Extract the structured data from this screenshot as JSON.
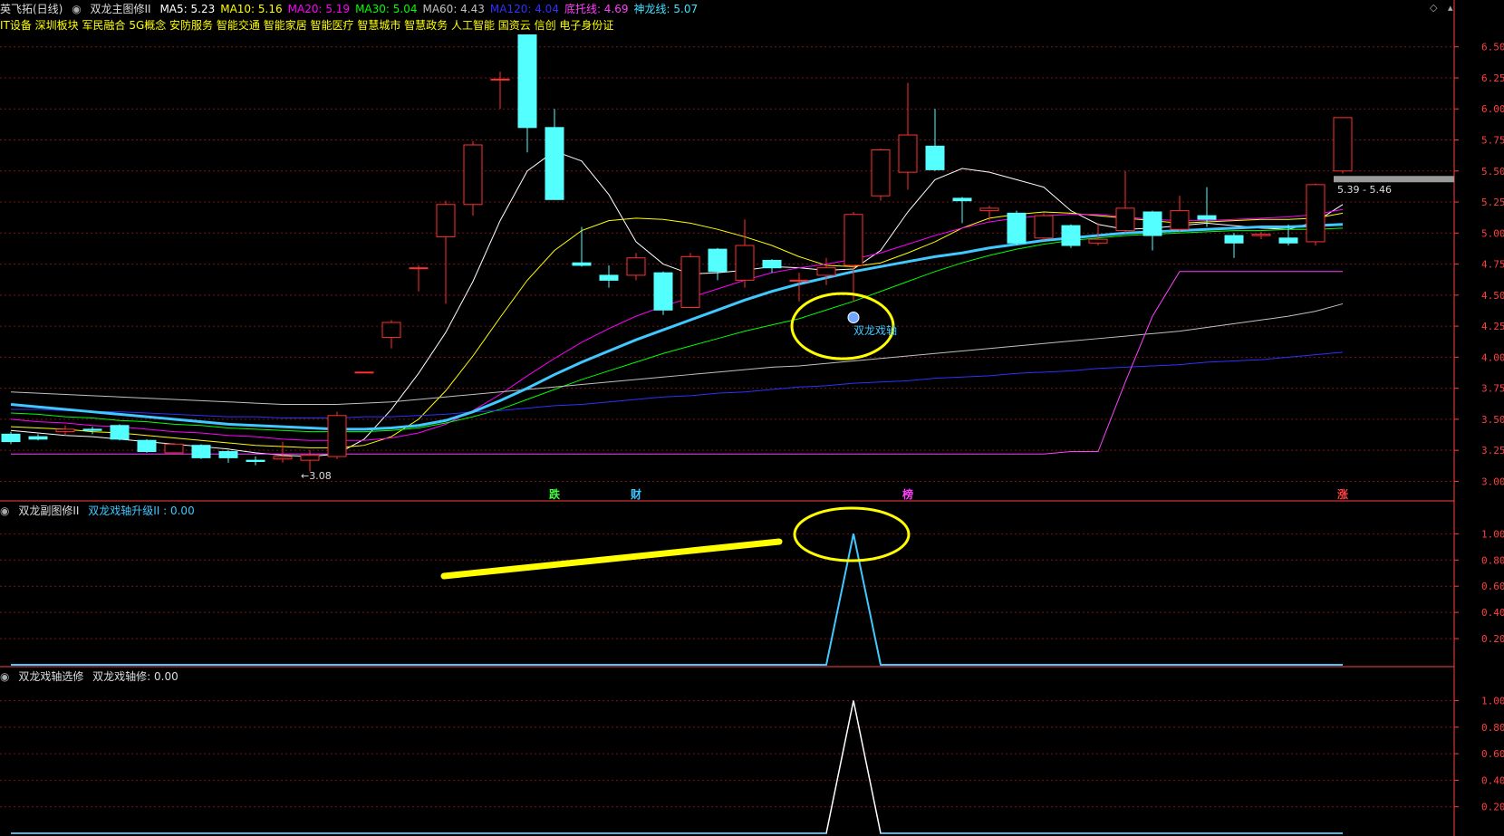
{
  "header": {
    "stock_name": "英飞拓(日线)",
    "indicator_name": "双龙主图修II",
    "ma_items": [
      {
        "label": "MA5: 5.23",
        "color": "#ffffff"
      },
      {
        "label": "MA10: 5.16",
        "color": "#ffff00"
      },
      {
        "label": "MA20: 5.19",
        "color": "#ff00ff"
      },
      {
        "label": "MA30: 5.04",
        "color": "#00ff00"
      },
      {
        "label": "MA60: 4.43",
        "color": "#c0c0c0"
      },
      {
        "label": "MA120: 4.04",
        "color": "#3030ff"
      },
      {
        "label": "底托线: 4.69",
        "color": "#ff40ff"
      },
      {
        "label": "神龙线: 5.07",
        "color": "#40e0ff"
      }
    ],
    "concepts": "IT设备 深圳板块 军民融合 5G概念 安防服务 智能交通 智能家居 智能医疗 智慧城市 智慧政务 人工智能 国资云 信创 电子身份证"
  },
  "colors": {
    "up": "#ff3030",
    "down": "#54ffff",
    "grid": "#7a1515",
    "axis": "#ff4040",
    "shenlong": "#40c8ff"
  },
  "annotations": {
    "signal_label": "双龙戏轴",
    "low_label": "←3.08",
    "range_label": "5.39 - 5.46",
    "markers": [
      {
        "text": "跌",
        "color": "#40ff40",
        "idx": 20
      },
      {
        "text": "财",
        "color": "#40c8ff",
        "idx": 23
      },
      {
        "text": "榜",
        "color": "#ff40ff",
        "idx": 33
      },
      {
        "text": "涨",
        "color": "#ff4040",
        "idx": 49
      }
    ]
  },
  "panel2": {
    "title": "双龙副图修II",
    "value_label": "双龙戏轴升级II : 0.00"
  },
  "panel3": {
    "title": "双龙戏轴选修",
    "value_label": "双龙戏轴修: 0.00"
  },
  "chart_data": [
    {
      "type": "candlestick",
      "name": "main",
      "ylim": [
        2.85,
        6.6
      ],
      "yticks": [
        "6.50",
        "6.25",
        "6.00",
        "5.75",
        "5.50",
        "5.25",
        "5.00",
        "4.75",
        "4.50",
        "4.25",
        "4.00",
        "3.75",
        "3.50",
        "3.25",
        "3.00"
      ],
      "candles": [
        {
          "o": 3.38,
          "c": 3.32,
          "h": 3.4,
          "l": 3.3
        },
        {
          "o": 3.36,
          "c": 3.34,
          "h": 3.38,
          "l": 3.33
        },
        {
          "o": 3.4,
          "c": 3.42,
          "h": 3.45,
          "l": 3.37
        },
        {
          "o": 3.42,
          "c": 3.41,
          "h": 3.44,
          "l": 3.38
        },
        {
          "o": 3.45,
          "c": 3.34,
          "h": 3.46,
          "l": 3.33
        },
        {
          "o": 3.33,
          "c": 3.24,
          "h": 3.34,
          "l": 3.23
        },
        {
          "o": 3.23,
          "c": 3.3,
          "h": 3.31,
          "l": 3.22
        },
        {
          "o": 3.29,
          "c": 3.19,
          "h": 3.3,
          "l": 3.18
        },
        {
          "o": 3.24,
          "c": 3.19,
          "h": 3.25,
          "l": 3.15
        },
        {
          "o": 3.17,
          "c": 3.16,
          "h": 3.2,
          "l": 3.13
        },
        {
          "o": 3.18,
          "c": 3.2,
          "h": 3.32,
          "l": 3.15
        },
        {
          "o": 3.17,
          "c": 3.21,
          "h": 3.25,
          "l": 3.08
        },
        {
          "o": 3.2,
          "c": 3.53,
          "h": 3.56,
          "l": 3.18
        },
        {
          "o": 3.88,
          "c": 3.88,
          "h": 3.88,
          "l": 3.88
        },
        {
          "o": 4.16,
          "c": 4.28,
          "h": 4.3,
          "l": 4.07
        },
        {
          "o": 4.72,
          "c": 4.72,
          "h": 4.74,
          "l": 4.53
        },
        {
          "o": 4.97,
          "c": 5.23,
          "h": 5.26,
          "l": 4.43
        },
        {
          "o": 5.23,
          "c": 5.71,
          "h": 5.74,
          "l": 5.14
        },
        {
          "o": 6.24,
          "c": 6.24,
          "h": 6.3,
          "l": 6.0
        },
        {
          "o": 6.9,
          "c": 5.85,
          "h": 6.9,
          "l": 5.65
        },
        {
          "o": 5.85,
          "c": 5.27,
          "h": 6.0,
          "l": 5.27
        },
        {
          "o": 4.76,
          "c": 4.74,
          "h": 5.05,
          "l": 4.73
        },
        {
          "o": 4.66,
          "c": 4.62,
          "h": 4.74,
          "l": 4.56
        },
        {
          "o": 4.66,
          "c": 4.8,
          "h": 4.84,
          "l": 4.62
        },
        {
          "o": 4.68,
          "c": 4.38,
          "h": 4.69,
          "l": 4.34
        },
        {
          "o": 4.4,
          "c": 4.81,
          "h": 4.84,
          "l": 4.4
        },
        {
          "o": 4.87,
          "c": 4.69,
          "h": 4.88,
          "l": 4.62
        },
        {
          "o": 4.62,
          "c": 4.9,
          "h": 5.11,
          "l": 4.56
        },
        {
          "o": 4.78,
          "c": 4.72,
          "h": 4.79,
          "l": 4.68
        },
        {
          "o": 4.62,
          "c": 4.62,
          "h": 4.68,
          "l": 4.45
        },
        {
          "o": 4.66,
          "c": 4.72,
          "h": 4.8,
          "l": 4.58
        },
        {
          "o": 4.74,
          "c": 5.15,
          "h": 5.17,
          "l": 4.45
        },
        {
          "o": 5.3,
          "c": 5.67,
          "h": 5.68,
          "l": 5.26
        },
        {
          "o": 5.49,
          "c": 5.79,
          "h": 6.21,
          "l": 5.35
        },
        {
          "o": 5.7,
          "c": 5.51,
          "h": 6.0,
          "l": 5.5
        },
        {
          "o": 5.28,
          "c": 5.26,
          "h": 5.29,
          "l": 5.08
        },
        {
          "o": 5.18,
          "c": 5.2,
          "h": 5.22,
          "l": 5.1
        },
        {
          "o": 5.16,
          "c": 4.92,
          "h": 5.18,
          "l": 4.9
        },
        {
          "o": 4.96,
          "c": 5.14,
          "h": 5.16,
          "l": 4.94
        },
        {
          "o": 5.06,
          "c": 4.9,
          "h": 5.07,
          "l": 4.88
        },
        {
          "o": 4.92,
          "c": 4.95,
          "h": 5.08,
          "l": 4.9
        },
        {
          "o": 5.02,
          "c": 5.2,
          "h": 5.5,
          "l": 5.0
        },
        {
          "o": 5.17,
          "c": 4.98,
          "h": 5.18,
          "l": 4.86
        },
        {
          "o": 5.03,
          "c": 5.18,
          "h": 5.3,
          "l": 5.0
        },
        {
          "o": 5.14,
          "c": 5.11,
          "h": 5.37,
          "l": 5.05
        },
        {
          "o": 4.98,
          "c": 4.92,
          "h": 5.0,
          "l": 4.8
        },
        {
          "o": 4.98,
          "c": 4.99,
          "h": 5.01,
          "l": 4.95
        },
        {
          "o": 4.96,
          "c": 4.92,
          "h": 5.07,
          "l": 4.9
        },
        {
          "o": 4.93,
          "c": 5.39,
          "h": 5.4,
          "l": 4.9
        },
        {
          "o": 5.5,
          "c": 5.93,
          "h": 5.93,
          "l": 5.48
        }
      ],
      "series": [
        {
          "name": "MA5",
          "color": "#ffffff",
          "width": 1,
          "values": [
            3.41,
            3.39,
            3.37,
            3.36,
            3.34,
            3.32,
            3.3,
            3.28,
            3.26,
            3.23,
            3.21,
            3.2,
            3.22,
            3.34,
            3.58,
            3.87,
            4.2,
            4.61,
            5.1,
            5.5,
            5.66,
            5.58,
            5.31,
            4.93,
            4.75,
            4.67,
            4.68,
            4.7,
            4.73,
            4.72,
            4.7,
            4.71,
            4.86,
            5.17,
            5.43,
            5.52,
            5.49,
            5.43,
            5.37,
            5.18,
            5.07,
            5.03,
            5.04,
            5.06,
            5.08,
            5.06,
            5.04,
            5.03,
            5.09,
            5.23
          ]
        },
        {
          "name": "MA10",
          "color": "#ffff00",
          "width": 1,
          "values": [
            3.44,
            3.43,
            3.42,
            3.4,
            3.39,
            3.37,
            3.35,
            3.33,
            3.31,
            3.29,
            3.28,
            3.27,
            3.27,
            3.29,
            3.36,
            3.5,
            3.73,
            4.01,
            4.32,
            4.62,
            4.86,
            5.02,
            5.1,
            5.12,
            5.11,
            5.08,
            5.03,
            4.97,
            4.9,
            4.81,
            4.74,
            4.73,
            4.76,
            4.84,
            4.93,
            5.04,
            5.12,
            5.15,
            5.17,
            5.16,
            5.14,
            5.12,
            5.1,
            5.08,
            5.09,
            5.1,
            5.11,
            5.11,
            5.12,
            5.16
          ]
        },
        {
          "name": "MA20",
          "color": "#ff00ff",
          "width": 1,
          "values": [
            3.5,
            3.48,
            3.47,
            3.45,
            3.44,
            3.42,
            3.4,
            3.39,
            3.37,
            3.36,
            3.34,
            3.33,
            3.33,
            3.33,
            3.35,
            3.39,
            3.46,
            3.57,
            3.7,
            3.85,
            3.99,
            4.12,
            4.23,
            4.33,
            4.41,
            4.48,
            4.55,
            4.62,
            4.68,
            4.72,
            4.75,
            4.79,
            4.84,
            4.91,
            4.98,
            5.04,
            5.09,
            5.12,
            5.14,
            5.15,
            5.15,
            5.13,
            5.11,
            5.1,
            5.1,
            5.11,
            5.12,
            5.13,
            5.15,
            5.19
          ]
        },
        {
          "name": "MA30",
          "color": "#00ff00",
          "width": 1,
          "values": [
            3.55,
            3.54,
            3.52,
            3.51,
            3.49,
            3.48,
            3.46,
            3.45,
            3.43,
            3.42,
            3.41,
            3.4,
            3.4,
            3.4,
            3.41,
            3.43,
            3.47,
            3.52,
            3.58,
            3.66,
            3.74,
            3.82,
            3.89,
            3.96,
            4.03,
            4.09,
            4.15,
            4.21,
            4.26,
            4.31,
            4.38,
            4.45,
            4.53,
            4.61,
            4.69,
            4.76,
            4.82,
            4.87,
            4.91,
            4.94,
            4.96,
            4.98,
            4.99,
            5.0,
            5.01,
            5.02,
            5.02,
            5.03,
            5.03,
            5.04
          ]
        },
        {
          "name": "MA60",
          "color": "#c0c0c0",
          "width": 1,
          "values": [
            3.72,
            3.71,
            3.7,
            3.69,
            3.68,
            3.67,
            3.66,
            3.65,
            3.64,
            3.63,
            3.62,
            3.62,
            3.62,
            3.63,
            3.64,
            3.66,
            3.68,
            3.7,
            3.72,
            3.74,
            3.76,
            3.78,
            3.8,
            3.82,
            3.84,
            3.86,
            3.88,
            3.9,
            3.92,
            3.93,
            3.95,
            3.97,
            3.99,
            4.01,
            4.03,
            4.05,
            4.07,
            4.09,
            4.11,
            4.13,
            4.15,
            4.17,
            4.19,
            4.21,
            4.24,
            4.27,
            4.3,
            4.33,
            4.37,
            4.43
          ]
        },
        {
          "name": "MA120",
          "color": "#3030ff",
          "width": 1,
          "values": [
            3.58,
            3.58,
            3.57,
            3.56,
            3.56,
            3.55,
            3.54,
            3.53,
            3.52,
            3.52,
            3.51,
            3.51,
            3.51,
            3.52,
            3.52,
            3.53,
            3.54,
            3.56,
            3.57,
            3.59,
            3.61,
            3.62,
            3.64,
            3.66,
            3.68,
            3.69,
            3.71,
            3.72,
            3.74,
            3.76,
            3.77,
            3.79,
            3.8,
            3.81,
            3.83,
            3.84,
            3.85,
            3.87,
            3.88,
            3.89,
            3.91,
            3.92,
            3.93,
            3.94,
            3.96,
            3.97,
            3.98,
            4.0,
            4.02,
            4.04
          ]
        },
        {
          "name": "底托线",
          "color": "#ff40ff",
          "width": 1,
          "values": [
            3.22,
            3.22,
            3.22,
            3.22,
            3.22,
            3.22,
            3.22,
            3.22,
            3.22,
            3.22,
            3.22,
            3.22,
            3.22,
            3.22,
            3.22,
            3.22,
            3.22,
            3.22,
            3.22,
            3.22,
            3.22,
            3.22,
            3.22,
            3.22,
            3.22,
            3.22,
            3.22,
            3.22,
            3.22,
            3.22,
            3.22,
            3.22,
            3.22,
            3.22,
            3.22,
            3.22,
            3.22,
            3.22,
            3.22,
            3.24,
            3.24,
            3.8,
            4.33,
            4.69,
            4.69,
            4.69,
            4.69,
            4.69,
            4.69,
            4.69
          ]
        },
        {
          "name": "神龙线",
          "color": "#40c8ff",
          "width": 3,
          "values": [
            3.62,
            3.6,
            3.58,
            3.56,
            3.54,
            3.52,
            3.5,
            3.48,
            3.46,
            3.45,
            3.44,
            3.43,
            3.42,
            3.42,
            3.43,
            3.45,
            3.49,
            3.56,
            3.65,
            3.75,
            3.86,
            3.96,
            4.05,
            4.14,
            4.22,
            4.3,
            4.38,
            4.46,
            4.53,
            4.59,
            4.64,
            4.69,
            4.73,
            4.77,
            4.81,
            4.84,
            4.88,
            4.91,
            4.94,
            4.96,
            4.98,
            5.0,
            5.01,
            5.02,
            5.03,
            5.04,
            5.05,
            5.05,
            5.06,
            5.07
          ]
        }
      ]
    },
    {
      "type": "line",
      "name": "双龙戏轴升级II",
      "ylim": [
        0,
        1.12
      ],
      "yticks": [
        "1.00",
        "0.80",
        "0.60",
        "0.40",
        "0.20"
      ],
      "color": "#40c8ff",
      "x_peak_idx": 31,
      "values": [
        0,
        0,
        0,
        0,
        0,
        0,
        0,
        0,
        0,
        0,
        0,
        0,
        0,
        0,
        0,
        0,
        0,
        0,
        0,
        0,
        0,
        0,
        0,
        0,
        0,
        0,
        0,
        0,
        0,
        0,
        0,
        1,
        0,
        0,
        0,
        0,
        0,
        0,
        0,
        0,
        0,
        0,
        0,
        0,
        0,
        0,
        0,
        0,
        0,
        0
      ]
    },
    {
      "type": "line",
      "name": "双龙戏轴修",
      "ylim": [
        0,
        1.12
      ],
      "yticks": [
        "1.00",
        "0.80",
        "0.60",
        "0.40",
        "0.20"
      ],
      "color": "#ffffff",
      "values": [
        0,
        0,
        0,
        0,
        0,
        0,
        0,
        0,
        0,
        0,
        0,
        0,
        0,
        0,
        0,
        0,
        0,
        0,
        0,
        0,
        0,
        0,
        0,
        0,
        0,
        0,
        0,
        0,
        0,
        0,
        0,
        1,
        0,
        0,
        0,
        0,
        0,
        0,
        0,
        0,
        0,
        0,
        0,
        0,
        0,
        0,
        0,
        0,
        0,
        0
      ]
    }
  ]
}
